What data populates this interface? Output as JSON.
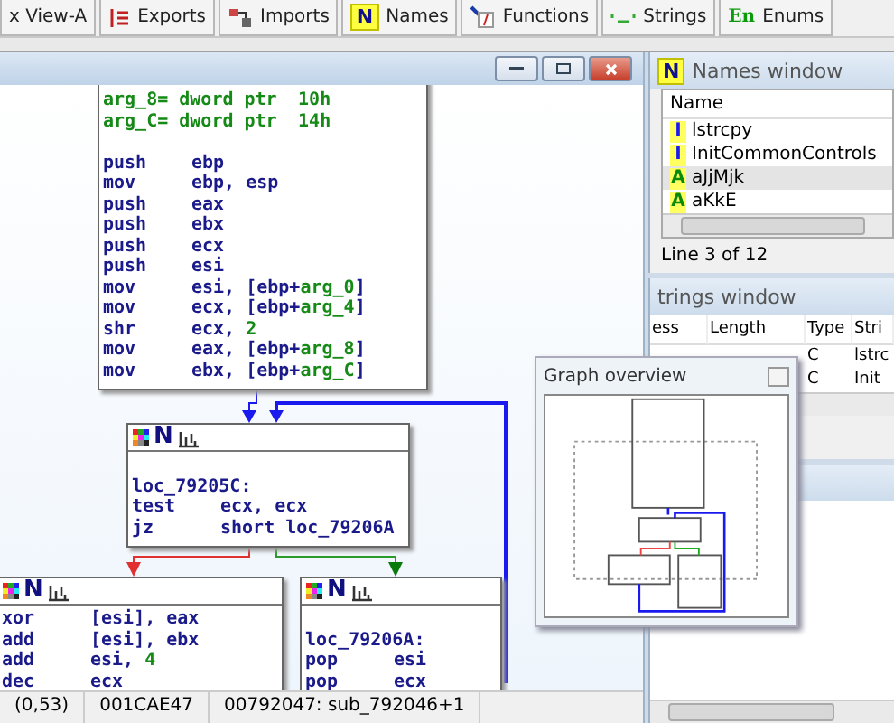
{
  "toolbar_tabs": [
    {
      "label": "x View-A",
      "kind": "hex"
    },
    {
      "label": "Exports",
      "kind": "exports"
    },
    {
      "label": "Imports",
      "kind": "imports"
    },
    {
      "label": "Names",
      "kind": "names",
      "icon_text": "N"
    },
    {
      "label": "Functions",
      "kind": "functions"
    },
    {
      "label": "Strings",
      "kind": "strings"
    },
    {
      "label": "Enums",
      "kind": "enums",
      "icon_text": "En"
    }
  ],
  "graph_view": {
    "blocks": [
      {
        "lines": [
          {
            "kind": "decl",
            "op": "arg_8= dword ptr",
            "args": [
              {
                "text": "10h",
                "kind": "num"
              }
            ]
          },
          {
            "kind": "decl",
            "op": "arg_C= dword ptr",
            "args": [
              {
                "text": "14h",
                "kind": "num"
              }
            ]
          },
          {
            "kind": "blank"
          },
          {
            "kind": "instr",
            "op": "push",
            "args": [
              {
                "text": "ebp",
                "kind": "reg"
              }
            ]
          },
          {
            "kind": "instr",
            "op": "mov",
            "args": [
              {
                "text": "ebp, esp",
                "kind": "reg"
              }
            ]
          },
          {
            "kind": "instr",
            "op": "push",
            "args": [
              {
                "text": "eax",
                "kind": "reg"
              }
            ]
          },
          {
            "kind": "instr",
            "op": "push",
            "args": [
              {
                "text": "ebx",
                "kind": "reg"
              }
            ]
          },
          {
            "kind": "instr",
            "op": "push",
            "args": [
              {
                "text": "ecx",
                "kind": "reg"
              }
            ]
          },
          {
            "kind": "instr",
            "op": "push",
            "args": [
              {
                "text": "esi",
                "kind": "reg"
              }
            ]
          },
          {
            "kind": "instr",
            "op": "mov",
            "args": [
              {
                "text": "esi, [ebp+",
                "kind": "reg"
              },
              {
                "text": "arg_0",
                "kind": "var"
              },
              {
                "text": "]",
                "kind": "reg"
              }
            ]
          },
          {
            "kind": "instr",
            "op": "mov",
            "args": [
              {
                "text": "ecx, [ebp+",
                "kind": "reg"
              },
              {
                "text": "arg_4",
                "kind": "var"
              },
              {
                "text": "]",
                "kind": "reg"
              }
            ]
          },
          {
            "kind": "instr",
            "op": "shr",
            "args": [
              {
                "text": "ecx, ",
                "kind": "reg"
              },
              {
                "text": "2",
                "kind": "num"
              }
            ]
          },
          {
            "kind": "instr",
            "op": "mov",
            "args": [
              {
                "text": "eax, [ebp+",
                "kind": "reg"
              },
              {
                "text": "arg_8",
                "kind": "var"
              },
              {
                "text": "]",
                "kind": "reg"
              }
            ]
          },
          {
            "kind": "instr",
            "op": "mov",
            "args": [
              {
                "text": "ebx, [ebp+",
                "kind": "reg"
              },
              {
                "text": "arg_C",
                "kind": "var"
              },
              {
                "text": "]",
                "kind": "reg"
              }
            ]
          }
        ]
      },
      {
        "header": "N",
        "lines": [
          {
            "kind": "blank"
          },
          {
            "kind": "label",
            "op": "loc_79205C:"
          },
          {
            "kind": "instr",
            "op": "test",
            "args": [
              {
                "text": "ecx, ecx",
                "kind": "reg"
              }
            ]
          },
          {
            "kind": "instr",
            "op": "jz",
            "args": [
              {
                "text": "short loc_79206A",
                "kind": "reg"
              }
            ]
          }
        ]
      },
      {
        "header": "N",
        "lines": [
          {
            "kind": "instr",
            "op": "xor",
            "args": [
              {
                "text": "[esi], eax",
                "kind": "reg"
              }
            ]
          },
          {
            "kind": "instr",
            "op": "add",
            "args": [
              {
                "text": "[esi], ebx",
                "kind": "reg"
              }
            ]
          },
          {
            "kind": "instr",
            "op": "add",
            "args": [
              {
                "text": "esi, ",
                "kind": "reg"
              },
              {
                "text": "4",
                "kind": "num"
              }
            ]
          },
          {
            "kind": "instr",
            "op": "dec",
            "args": [
              {
                "text": "ecx",
                "kind": "reg"
              }
            ]
          }
        ]
      },
      {
        "header": "N",
        "lines": [
          {
            "kind": "blank"
          },
          {
            "kind": "label",
            "op": "loc_79206A:"
          },
          {
            "kind": "instr",
            "op": "pop",
            "args": [
              {
                "text": "esi",
                "kind": "reg"
              }
            ]
          },
          {
            "kind": "instr",
            "op": "pop",
            "args": [
              {
                "text": "ecx",
                "kind": "reg"
              }
            ]
          }
        ]
      }
    ],
    "status_bar": [
      "(0,53)",
      "001CAE47",
      "00792047: sub_792046+1"
    ]
  },
  "names_window": {
    "title": "Names window",
    "title_icon": "N",
    "column": "Name",
    "rows": [
      {
        "icon": "I",
        "kind": "import",
        "name": "lstrcpy",
        "selected": false
      },
      {
        "icon": "I",
        "kind": "import",
        "name": "InitCommonControls",
        "selected": false
      },
      {
        "icon": "A",
        "kind": "string",
        "name": "aJjMjk",
        "selected": true
      },
      {
        "icon": "A",
        "kind": "string",
        "name": "aKkE",
        "selected": false
      }
    ],
    "status": "Line 3 of 12"
  },
  "strings_window": {
    "title": "trings window",
    "columns": [
      "ess",
      "Length",
      "Type",
      "Stri"
    ],
    "rows": [
      [
        "C",
        "lstrc"
      ],
      [
        "C",
        "Init"
      ]
    ]
  },
  "graph_overview": {
    "title": "Graph overview"
  }
}
